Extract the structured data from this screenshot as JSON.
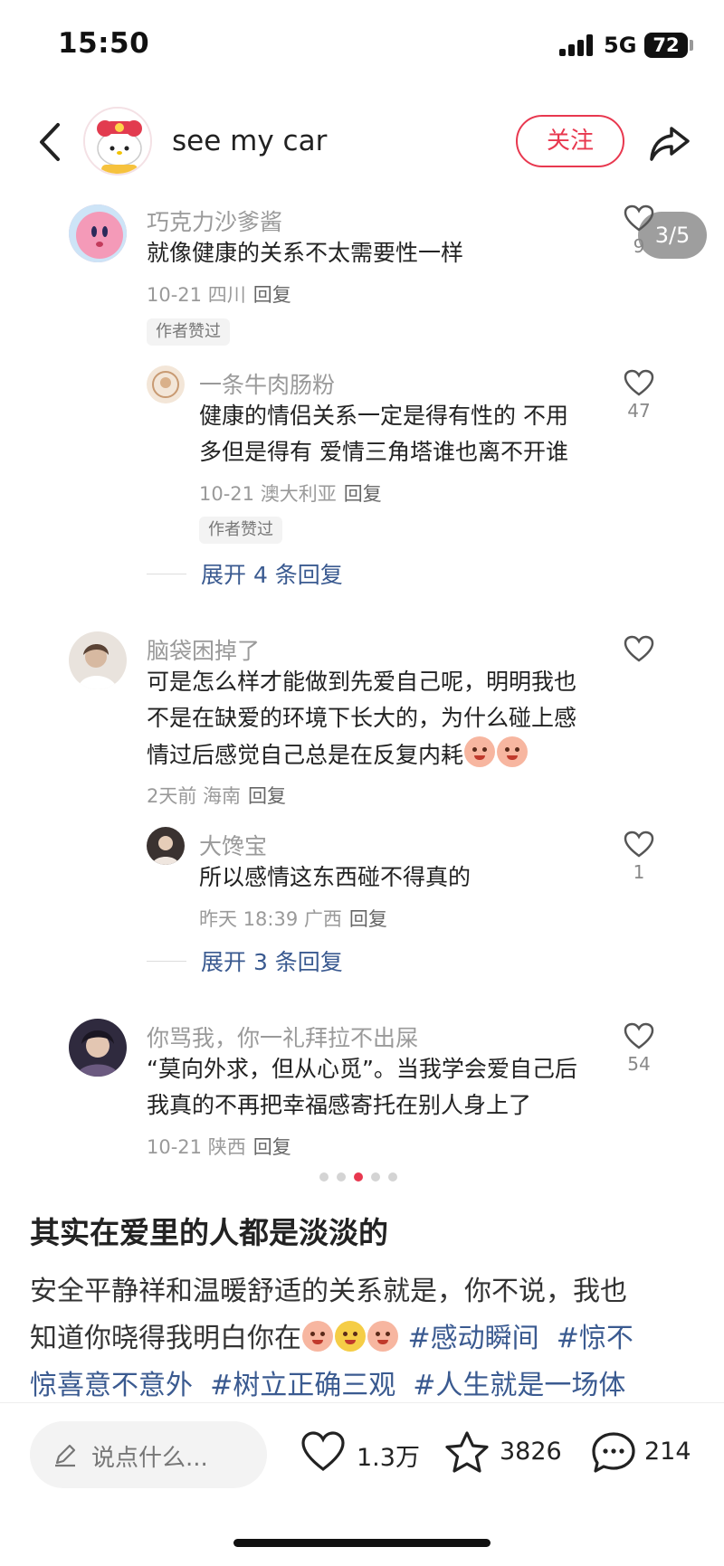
{
  "status_bar": {
    "time": "15:50",
    "network": "5G",
    "battery": "72"
  },
  "header": {
    "username": "see my car",
    "follow_label": "关注"
  },
  "image_counter": "3/5",
  "comments": [
    {
      "username": "巧克力沙爹酱",
      "text_lines": [
        "就像健康的关系不太需要性一样"
      ],
      "meta_date": "10-21 四川",
      "reply_label": "回复",
      "tag": "作者赞过",
      "likes": "9",
      "replies": [
        {
          "username": "一条牛肉肠粉",
          "text_lines": [
            "健康的情侣关系一定是得有性的 不用",
            "多但是得有 爱情三角塔谁也离不开谁"
          ],
          "meta_date": "10-21 澳大利亚",
          "reply_label": "回复",
          "tag": "作者赞过",
          "likes": "47"
        }
      ],
      "expand_label": "展开 4 条回复"
    },
    {
      "username": "脑袋困掉了",
      "text_lines": [
        "可是怎么样才能做到先爱自己呢，明明我也",
        "不是在缺爱的环境下长大的，为什么碰上感",
        "情过后感觉自己总是在反复内耗"
      ],
      "meta_date": "2天前 海南",
      "reply_label": "回复",
      "likes": "",
      "replies": [
        {
          "username": "大馋宝",
          "text_lines": [
            "所以感情这东西碰不得真的"
          ],
          "meta_date": "昨天 18:39 广西",
          "reply_label": "回复",
          "likes": "1"
        }
      ],
      "expand_label": "展开 3 条回复"
    },
    {
      "username": "你骂我，你一礼拜拉不出屎",
      "text_lines": [
        "“莫向外求，但从心觅”。当我学会爱自己后",
        "我真的不再把幸福感寄托在别人身上了"
      ],
      "meta_date": "10-21 陕西",
      "reply_label": "回复",
      "likes": "54"
    }
  ],
  "carousel": {
    "count": 5,
    "active_index": 2,
    "active_color": "#e8384f"
  },
  "post": {
    "title": "其实在爱里的人都是淡淡的",
    "body_line1": "安全平静祥和温暖舒适的关系就是，你不说，我也",
    "body_line2_text": "知道你晓得我明白你在",
    "hashtags": [
      "#感动瞬间",
      "#惊不",
      "惊喜意不意外",
      "#树立正确三观",
      "#人生就是一场体"
    ]
  },
  "bottom_bar": {
    "input_placeholder": "说点什么...",
    "likes": "1.3万",
    "favorites": "3826",
    "comments": "214"
  },
  "colors": {
    "accent": "#e8384f",
    "link": "#3a5a90",
    "meta": "#9a9a9a"
  },
  "icons": [
    "back-arrow-icon",
    "share-icon",
    "heart-icon",
    "star-icon",
    "comment-icon",
    "pen-icon"
  ]
}
